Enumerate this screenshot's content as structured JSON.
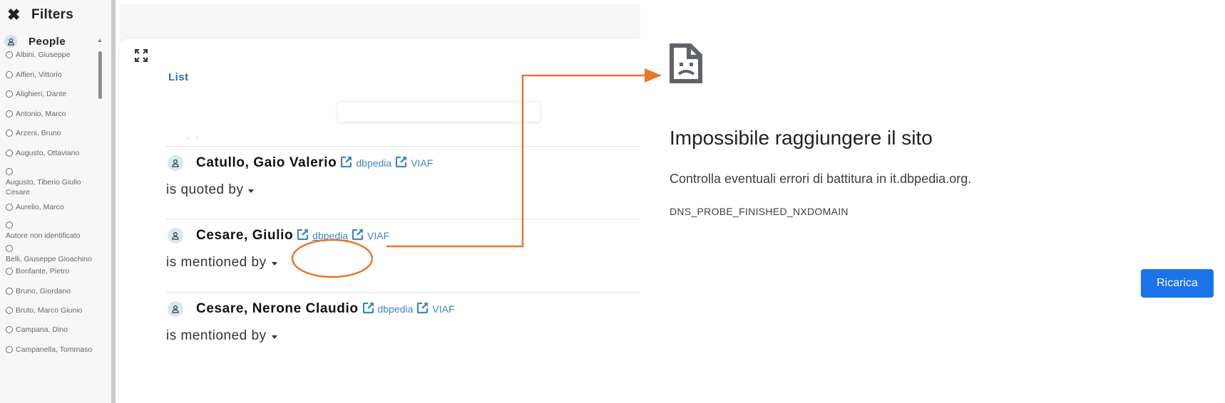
{
  "sidebar": {
    "filters_title": "Filters",
    "people_title": "People",
    "people": [
      "Albini, Giuseppe",
      "Alfieri, Vittorio",
      "Alighieri, Dante",
      "Antonio, Marco",
      "Arzeni, Bruno",
      "Augusto, Ottaviano",
      "Augusto, Tiberio Giulio Cesare",
      "Aurelio, Marco",
      "Autore non identificato",
      "Belli, Giuseppe Gioachino",
      "Bonfante, Pietro",
      "Bruno, Giordano",
      "Bruto, Marco Giunio",
      "Campana, Dino",
      "Campanella, Tommaso"
    ]
  },
  "main": {
    "list_tab": "List",
    "entries": [
      {
        "name": "Catullo, Gaio Valerio",
        "link1": "dbpedia",
        "link2": "VIAF",
        "relation": "is quoted by"
      },
      {
        "name": "Cesare, Giulio",
        "link1": "dbpedia",
        "link2": "VIAF",
        "relation": "is mentioned by"
      },
      {
        "name": "Cesare, Nerone Claudio",
        "link1": "dbpedia",
        "link2": "VIAF",
        "relation": "is mentioned by"
      }
    ]
  },
  "error_page": {
    "title": "Impossibile raggiungere il sito",
    "description": "Controlla eventuali errori di battitura in it.dbpedia.org.",
    "code": "DNS_PROBE_FINISHED_NXDOMAIN",
    "reload_label": "Ricarica",
    "button_color": "#1a73e8"
  },
  "annotation": {
    "color": "#e8772e"
  }
}
